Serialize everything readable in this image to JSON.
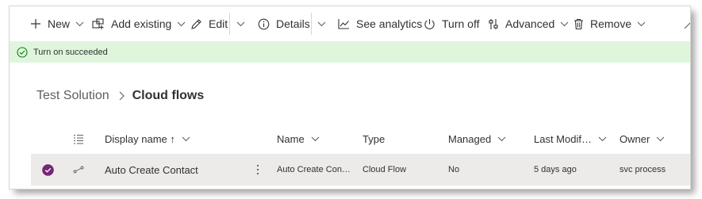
{
  "toolbar": {
    "new_label": "New",
    "add_existing_label": "Add existing",
    "edit_label": "Edit",
    "details_label": "Details",
    "see_analytics_label": "See analytics",
    "turn_off_label": "Turn off",
    "advanced_label": "Advanced",
    "remove_label": "Remove"
  },
  "notification": {
    "message": "Turn on succeeded",
    "status_color": "#107c10"
  },
  "breadcrumb": {
    "parent": "Test Solution",
    "current": "Cloud flows"
  },
  "table": {
    "columns": {
      "display_name": "Display name ↑",
      "name": "Name",
      "type": "Type",
      "managed": "Managed",
      "last_modified": "Last Modif…",
      "owner": "Owner"
    },
    "rows": [
      {
        "selected": true,
        "display_name": "Auto Create Contact",
        "name": "Auto Create Con…",
        "type": "Cloud Flow",
        "managed": "No",
        "last_modified": "5 days ago",
        "owner": "svc process"
      }
    ]
  },
  "colors": {
    "accent_purple": "#742774",
    "banner_bg": "#dff6dd",
    "row_selected_bg": "#edebe9"
  }
}
